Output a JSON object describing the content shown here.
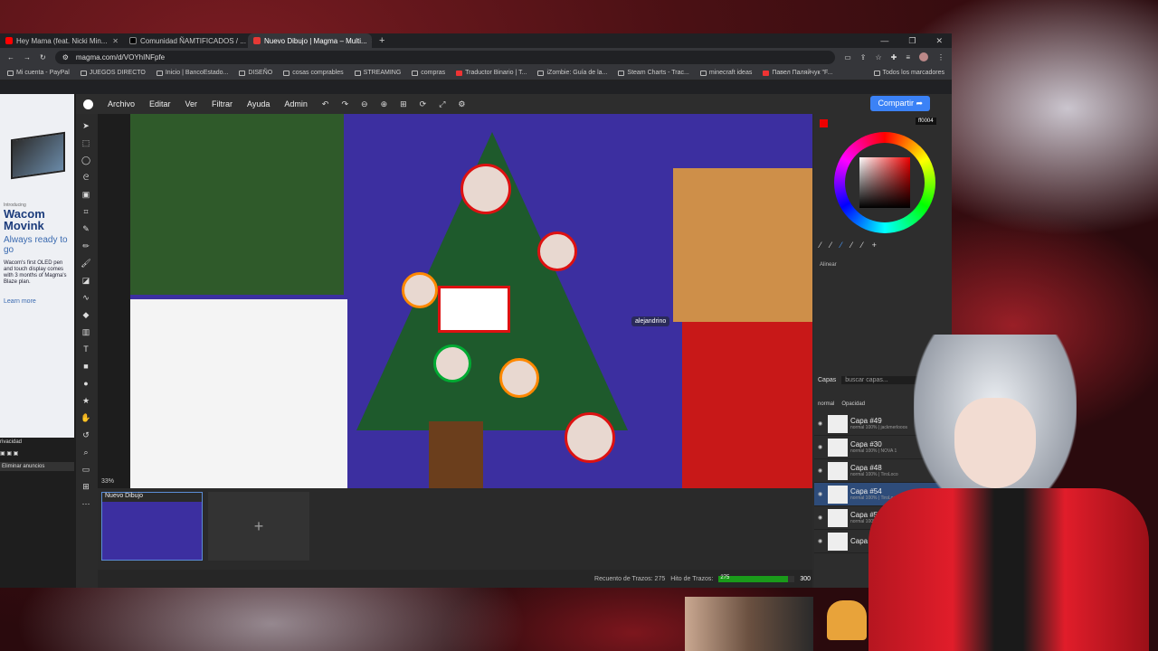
{
  "browser": {
    "tabs": [
      {
        "title": "Hey Mama (feat. Nicki Min...",
        "fav_color": "#ff0000"
      },
      {
        "title": "Comunidad ÑAMTIFICADOS / ...",
        "fav_color": "#000000"
      },
      {
        "title": "Nuevo Dibujo | Magma – Multi...",
        "fav_color": "#e53935"
      }
    ],
    "new_tab": "+",
    "url": "magma.com/d/VOYhINFpfe",
    "bookmarks": [
      "Mi cuenta - PayPal",
      "JUEGOS DIRECTO",
      "Inicio | BancoEstado...",
      "DISEÑO",
      "cosas comprables",
      "STREAMING",
      "compras",
      "Traductor Binario | T...",
      "iZombie: Guía de la...",
      "Steam Charts - Trac...",
      "minecraft ideas",
      "Павел Паляйчук \"F..."
    ],
    "all_bookmarks": "Todos los marcadores"
  },
  "ad": {
    "small": "Introducing",
    "brand": "Wacom Movink",
    "tagline": "Always ready to go",
    "desc": "Wacom's first OLED pen and touch display comes with 3 months of Magma's Blaze plan.",
    "learn": "Learn more"
  },
  "privacy": {
    "label": "rivacidad",
    "remove": "Eliminar anuncios"
  },
  "magma": {
    "menu": [
      "Archivo",
      "Editar",
      "Ver",
      "Filtrar",
      "Ayuda",
      "Admin"
    ],
    "share": "Compartir",
    "zoom": "33%",
    "cursor_user": "alejandrino",
    "drawing_title": "Nuevo Dibujo",
    "add_slot": "+",
    "status": {
      "stroke_count_label": "Recuento de Trazos: 275",
      "stroke_hit_label": "Hito de Trazos:",
      "hit_value": "275",
      "hit_max": "300",
      "hit_fraction": 0.917
    },
    "color": {
      "hex": "ff0004",
      "primary": "#ff0000",
      "secondary": "#f5a700"
    },
    "align_label": "Alinear",
    "layers_title": "Capas",
    "layers_search": "buscar capas...",
    "blend_mode": "normal",
    "opacity_label": "Opacidad",
    "layers": [
      {
        "name": "Capa #49",
        "sub": "normal 100% | jackmerlooos"
      },
      {
        "name": "Capa #30",
        "sub": "normal 100% | NOVA 1"
      },
      {
        "name": "Capa #48",
        "sub": "normal 100% | TiroLoco"
      },
      {
        "name": "Capa #54",
        "sub": "normal 100% | TiroLoco"
      },
      {
        "name": "Capa #53",
        "sub": "normal 100%"
      },
      {
        "name": "Capa",
        "sub": ""
      }
    ]
  }
}
